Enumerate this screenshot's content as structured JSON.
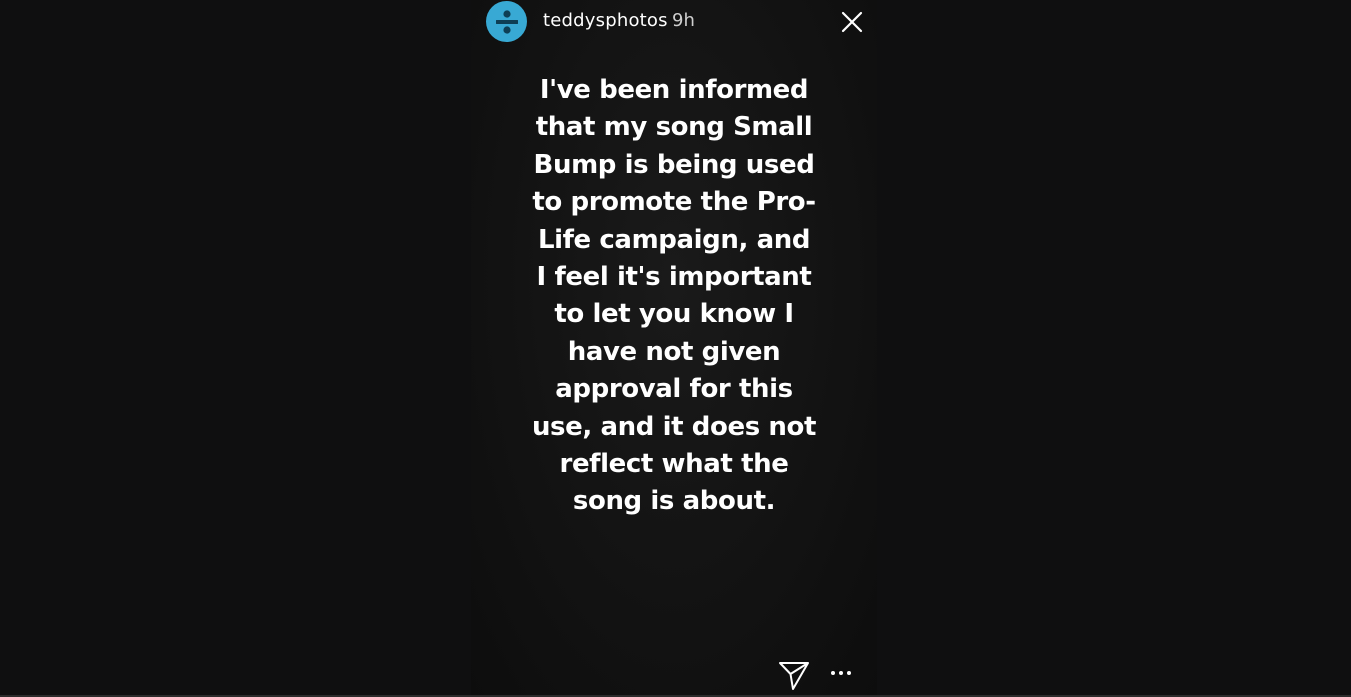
{
  "story": {
    "username": "teddysphotos",
    "timestamp": "9h",
    "lines": [
      "I've been informed",
      "that my song Small",
      "Bump is being used",
      "to promote the Pro-",
      "Life campaign, and",
      "I feel it's important",
      "to let you know I",
      "have not given",
      "approval for this",
      "use, and it does not",
      "reflect what the",
      "song is about."
    ]
  },
  "icons": {
    "avatar": "divide-logo-avatar",
    "close": "close-icon",
    "share": "send-icon",
    "more": "more-options-icon"
  },
  "colors": {
    "avatar_bg": "#38a9d4",
    "background": "#0f0f10",
    "text": "#ffffff"
  }
}
